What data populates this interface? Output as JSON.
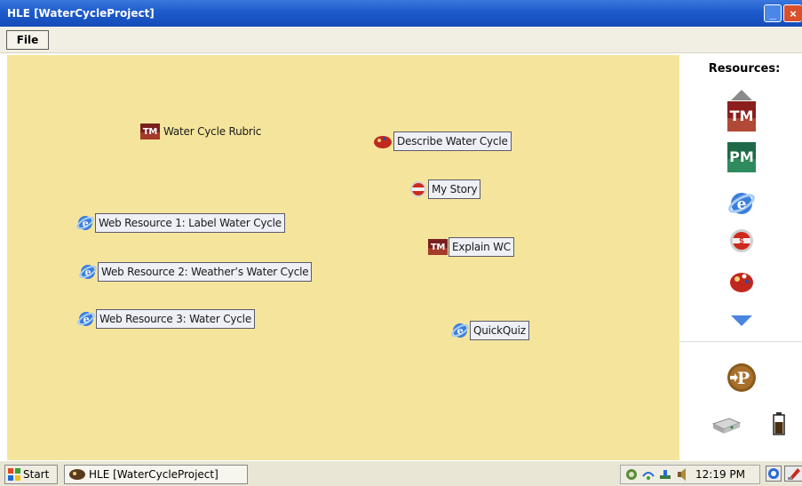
{
  "window": {
    "title": "HLE [WaterCycleProject]",
    "minimize_glyph": "_",
    "close_glyph": "×"
  },
  "menu": {
    "file_label": "File"
  },
  "canvas": {
    "background": "#f5e59c",
    "nodes": [
      {
        "id": "rubric",
        "label": "Water Cycle Rubric",
        "icon": "tm-icon"
      },
      {
        "id": "describe",
        "label": "Describe Water Cycle",
        "icon": "paint-palette-icon"
      },
      {
        "id": "mystory",
        "label": "My Story",
        "icon": "story-icon"
      },
      {
        "id": "web1",
        "label": "Web Resource 1: Label Water Cycle",
        "icon": "internet-explorer-icon"
      },
      {
        "id": "explain",
        "label": "Explain WC",
        "icon": "tm-icon"
      },
      {
        "id": "web2",
        "label": "Web Resource 2: Weather’s Water Cycle",
        "icon": "internet-explorer-icon"
      },
      {
        "id": "web3",
        "label": "Web Resource 3: Water Cycle",
        "icon": "internet-explorer-icon"
      },
      {
        "id": "quickquiz",
        "label": "QuickQuiz",
        "icon": "internet-explorer-icon"
      }
    ]
  },
  "resources": {
    "title": "Resources:",
    "items": [
      {
        "icon": "scroll-up-arrow-icon"
      },
      {
        "icon": "tm-icon",
        "text": "TM"
      },
      {
        "icon": "pm-icon",
        "text": "PM"
      },
      {
        "icon": "internet-explorer-icon"
      },
      {
        "icon": "story-icon"
      },
      {
        "icon": "paint-palette-icon"
      },
      {
        "icon": "scroll-down-arrow-icon"
      }
    ],
    "bottom": [
      {
        "icon": "publish-icon",
        "text": "P"
      },
      {
        "icon": "drive-icon"
      },
      {
        "icon": "battery-icon"
      }
    ]
  },
  "taskbar": {
    "start_label": "Start",
    "task_label": "HLE [WaterCycleProject]",
    "clock": "12:19 PM"
  }
}
